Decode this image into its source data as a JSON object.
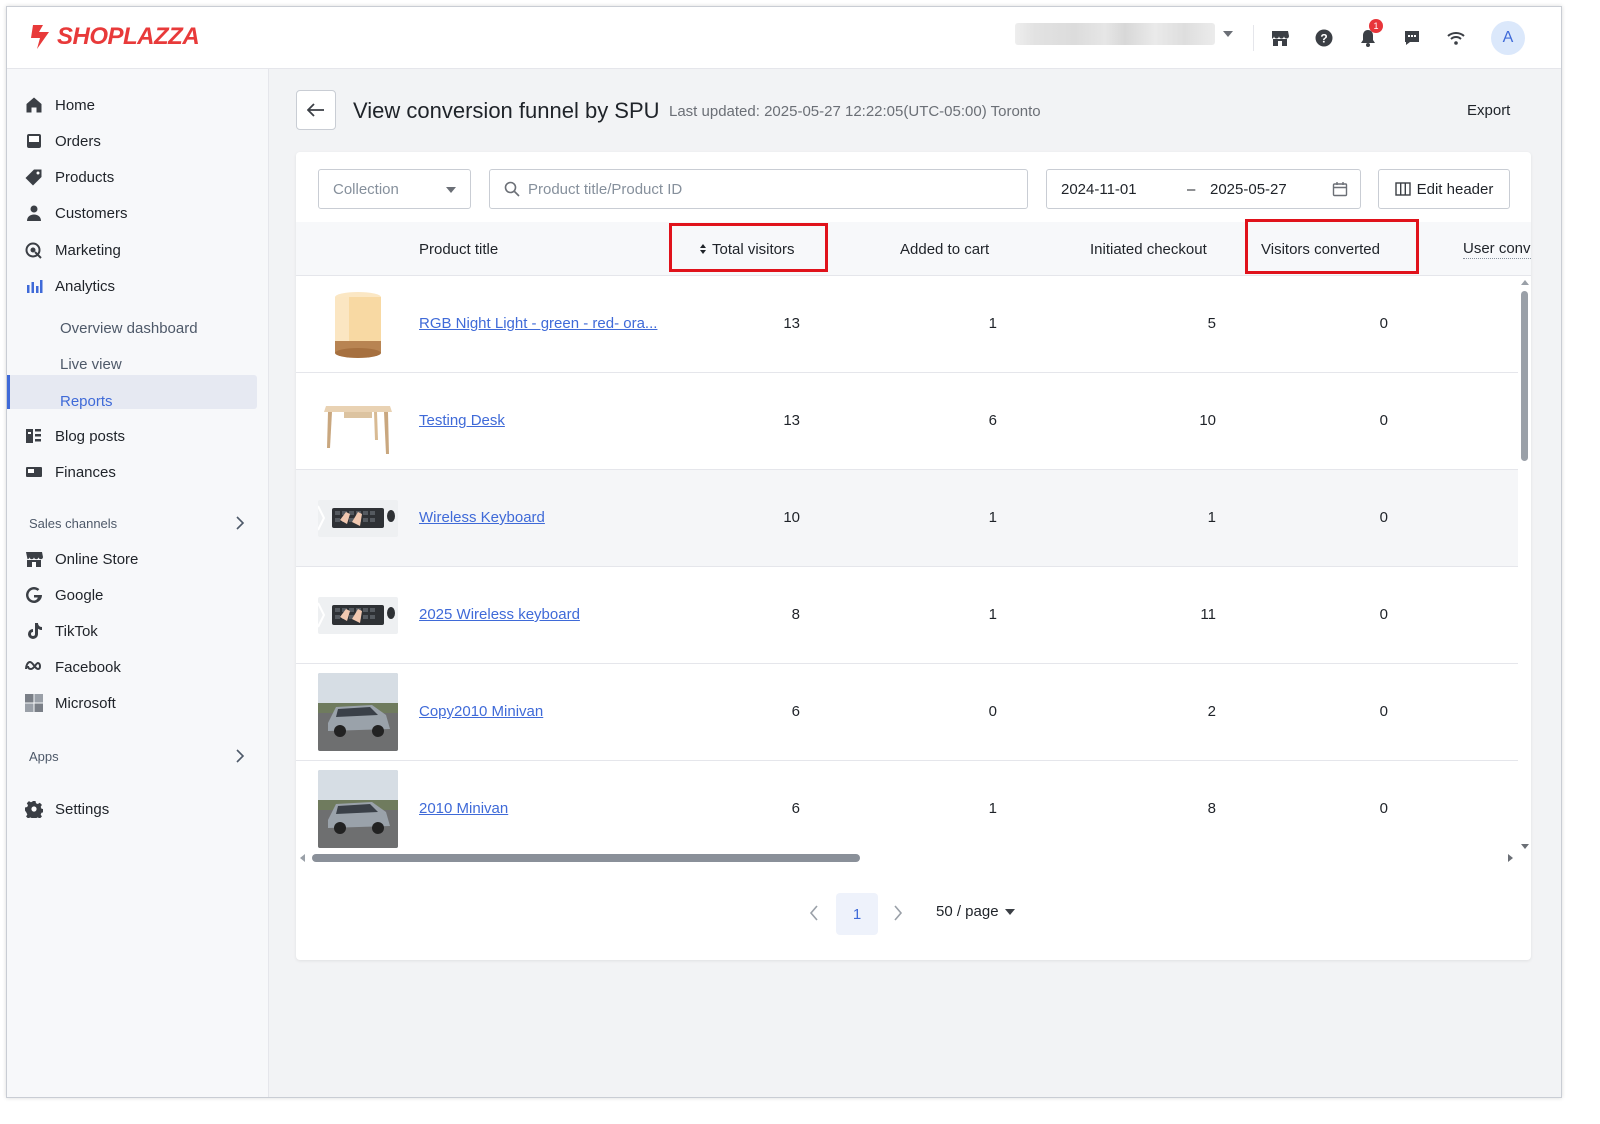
{
  "brand": {
    "name": "SHOPLAZZA",
    "color": "#e83a3a",
    "accent": "#3f6ad8"
  },
  "header": {
    "notification_count": "1",
    "avatar_initial": "A",
    "icons": [
      "storefront-icon",
      "help-icon",
      "bell-icon",
      "chat-icon",
      "wifi-icon"
    ]
  },
  "sidebar": {
    "items": [
      {
        "label": "Home",
        "icon": "home-icon"
      },
      {
        "label": "Orders",
        "icon": "inbox-icon"
      },
      {
        "label": "Products",
        "icon": "tag-icon"
      },
      {
        "label": "Customers",
        "icon": "person-icon"
      },
      {
        "label": "Marketing",
        "icon": "target-icon"
      },
      {
        "label": "Analytics",
        "icon": "bar-chart-icon"
      }
    ],
    "analytics_sub": [
      {
        "label": "Overview dashboard"
      },
      {
        "label": "Live view"
      },
      {
        "label": "Reports",
        "active": true
      }
    ],
    "items2": [
      {
        "label": "Blog posts",
        "icon": "blog-icon"
      },
      {
        "label": "Finances",
        "icon": "finance-icon"
      }
    ],
    "sales_channels_title": "Sales channels",
    "channels": [
      {
        "label": "Online Store",
        "icon": "storefront-icon"
      },
      {
        "label": "Google",
        "icon": "google-icon"
      },
      {
        "label": "TikTok",
        "icon": "tiktok-icon"
      },
      {
        "label": "Facebook",
        "icon": "meta-icon"
      },
      {
        "label": "Microsoft",
        "icon": "microsoft-icon"
      }
    ],
    "apps_title": "Apps",
    "settings_label": "Settings"
  },
  "page": {
    "title": "View conversion funnel by SPU",
    "last_updated": "Last updated: 2025-05-27 12:22:05(UTC-05:00) Toronto",
    "export_label": "Export"
  },
  "filters": {
    "collection_placeholder": "Collection",
    "search_placeholder": "Product title/Product ID",
    "date_start": "2024-11-01",
    "date_separator": "–",
    "date_end": "2025-05-27",
    "edit_header_label": "Edit header"
  },
  "table": {
    "columns": [
      "Product title",
      "Total visitors",
      "Added to cart",
      "Initiated checkout",
      "Visitors converted",
      "User conv"
    ],
    "highlighted_columns": [
      "Total visitors",
      "Visitors converted"
    ],
    "rows": [
      {
        "title": "RGB Night Light - green - red- ora...",
        "image": "night-light",
        "total_visitors": "13",
        "added_to_cart": "1",
        "initiated_checkout": "5",
        "visitors_converted": "0"
      },
      {
        "title": "Testing Desk",
        "image": "desk",
        "total_visitors": "13",
        "added_to_cart": "6",
        "initiated_checkout": "10",
        "visitors_converted": "0"
      },
      {
        "title": "Wireless Keyboard",
        "image": "keyboard",
        "total_visitors": "10",
        "added_to_cart": "1",
        "initiated_checkout": "1",
        "visitors_converted": "0"
      },
      {
        "title": "2025 Wireless keyboard",
        "image": "keyboard",
        "total_visitors": "8",
        "added_to_cart": "1",
        "initiated_checkout": "11",
        "visitors_converted": "0"
      },
      {
        "title": "Copy2010 Minivan",
        "image": "minivan",
        "total_visitors": "6",
        "added_to_cart": "0",
        "initiated_checkout": "2",
        "visitors_converted": "0"
      },
      {
        "title": "2010 Minivan",
        "image": "minivan",
        "total_visitors": "6",
        "added_to_cart": "1",
        "initiated_checkout": "8",
        "visitors_converted": "0"
      }
    ]
  },
  "pagination": {
    "current_page": "1",
    "page_size": "50 / page"
  }
}
